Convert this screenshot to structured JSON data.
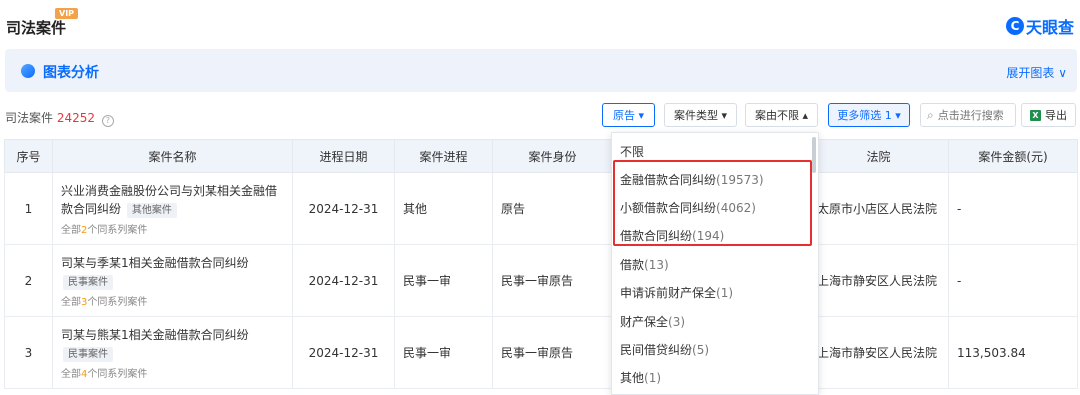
{
  "header": {
    "title": "司法案件",
    "vip_badge": "VIP",
    "logo_mark": "C",
    "logo_text": "天眼查"
  },
  "analysis": {
    "title": "图表分析",
    "expand_label": "展开图表 ∨"
  },
  "toolbar": {
    "count_label": "司法案件",
    "count_value": "24252",
    "help_glyph": "?",
    "filters": [
      {
        "label": "原告 ▾"
      },
      {
        "label": "案件类型 ▾"
      },
      {
        "label": "案由不限 ▴"
      },
      {
        "label": "更多筛选 1 ▾"
      }
    ],
    "search_placeholder": "点击进行搜索",
    "search_icon": "⌕",
    "export_label": "导出",
    "excel_glyph": "X"
  },
  "table": {
    "headers": [
      "序号",
      "案件名称",
      "进程日期",
      "案件进程",
      "案件身份",
      "",
      "法院",
      "案件金额(元)"
    ],
    "rows": [
      {
        "index": "1",
        "name": "兴业消费金融股份公司与刘某相关金融借款合同纠纷",
        "tag": "其他案件",
        "series_prefix": "全部",
        "series_num": "2",
        "series_suffix": "个同系列案件",
        "date": "2024-12-31",
        "progress": "其他",
        "role": "原告",
        "court": "太原市小店区人民法院",
        "amount": "-"
      },
      {
        "index": "2",
        "name": "司某与季某1相关金融借款合同纠纷",
        "tag": "民事案件",
        "series_prefix": "全部",
        "series_num": "3",
        "series_suffix": "个同系列案件",
        "date": "2024-12-31",
        "progress": "民事一审",
        "role": "民事一审原告",
        "court": "上海市静安区人民法院",
        "amount": "-"
      },
      {
        "index": "3",
        "name": "司某与熊某1相关金融借款合同纠纷",
        "tag": "民事案件",
        "series_prefix": "全部",
        "series_num": "4",
        "series_suffix": "个同系列案件",
        "date": "2024-12-31",
        "progress": "民事一审",
        "role": "民事一审原告",
        "court": "上海市静安区人民法院",
        "amount": "113,503.84"
      }
    ]
  },
  "dropdown": {
    "items": [
      {
        "label": "不限",
        "count": ""
      },
      {
        "label": "金融借款合同纠纷",
        "count": "(19573)"
      },
      {
        "label": "小额借款合同纠纷",
        "count": "(4062)"
      },
      {
        "label": "借款合同纠纷",
        "count": "(194)"
      },
      {
        "label": "借款",
        "count": "(13)"
      },
      {
        "label": "申请诉前财产保全",
        "count": "(1)"
      },
      {
        "label": "财产保全",
        "count": "(3)"
      },
      {
        "label": "民间借贷纠纷",
        "count": "(5)"
      },
      {
        "label": "其他",
        "count": "(1)"
      }
    ]
  },
  "colors": {
    "brand": "#0a6cff",
    "highlight": "#e5302f",
    "count": "#e4393c",
    "series": "#f39c12"
  }
}
